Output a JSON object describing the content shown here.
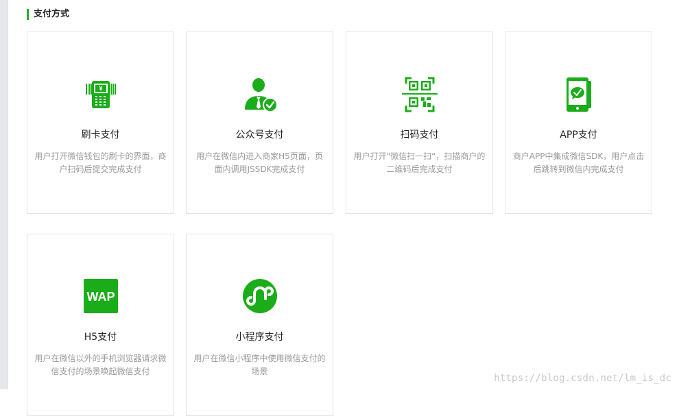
{
  "section": {
    "title": "支付方式"
  },
  "colors": {
    "accent": "#23b026",
    "icon": "#1aad19"
  },
  "cards": [
    {
      "icon": "card-reader-icon",
      "title": "刷卡支付",
      "desc": "用户打开微信钱包的刷卡的界面，商户扫码后提交完成支付"
    },
    {
      "icon": "official-account-icon",
      "title": "公众号支付",
      "desc": "用户在微信内进入商家H5页面，页面内调用JSSDK完成支付"
    },
    {
      "icon": "qr-scan-icon",
      "title": "扫码支付",
      "desc": "用户打开\"微信扫一扫“，扫描商户的二维码后完成支付"
    },
    {
      "icon": "app-phone-icon",
      "title": "APP支付",
      "desc": "商户APP中集成微信SDK，用户点击后跳转到微信内完成支付"
    },
    {
      "icon": "wap-icon",
      "title": "H5支付",
      "desc": "用户在微信以外的手机浏览器请求微信支付的场景唤起微信支付",
      "icon_text": "WAP"
    },
    {
      "icon": "mini-program-icon",
      "title": "小程序支付",
      "desc": "用户在微信小程序中使用微信支付的场景"
    }
  ],
  "watermark": "https://blog.csdn.net/lm_is_dc"
}
